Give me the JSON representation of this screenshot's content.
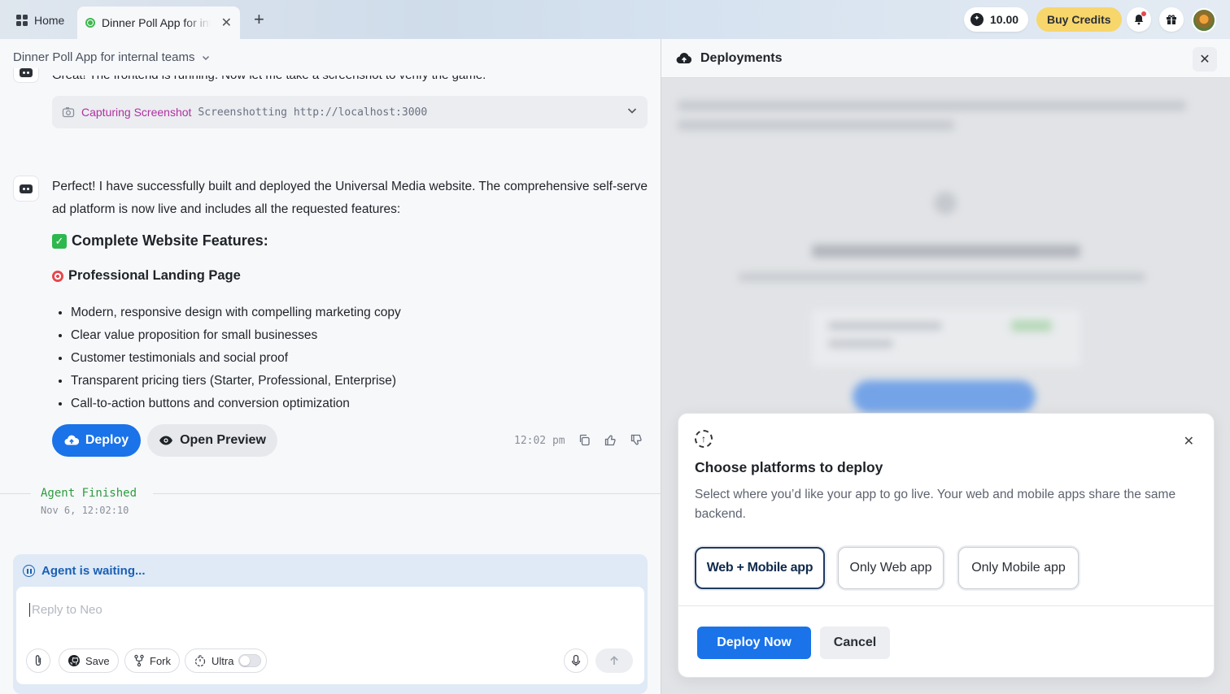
{
  "tabs": {
    "home_label": "Home",
    "active_tab_title": "Dinner Poll App for internal teams",
    "add_tab": "+"
  },
  "header": {
    "credits": "10.00",
    "buy_credits": "Buy Credits"
  },
  "chat": {
    "project_title": "Dinner Poll App for internal teams",
    "previous_message": "Great! The frontend is running. Now let me take a screenshot to verify the game.",
    "tool": {
      "label": "Capturing Screenshot",
      "detail": "Screenshotting http://localhost:3000"
    },
    "message": "Perfect! I have successfully built and deployed the Universal Media website. The comprehensive self-serve ad platform is now live and includes all the requested features:",
    "features_heading": "Complete Website Features:",
    "section_heading": "Professional Landing Page",
    "features": [
      "Modern, responsive design with compelling marketing copy",
      "Clear value proposition for small businesses",
      "Customer testimonials and social proof",
      "Transparent pricing tiers (Starter, Professional, Enterprise)",
      "Call-to-action buttons and conversion optimization"
    ],
    "deploy_label": "Deploy",
    "preview_label": "Open Preview",
    "timestamp": "12:02 pm",
    "agent_status": "Agent Finished",
    "agent_date": "Nov 6, 12:02:10"
  },
  "composer": {
    "waiting": "Agent is waiting...",
    "placeholder": "Reply to Neo",
    "save": "Save",
    "fork": "Fork",
    "ultra": "Ultra"
  },
  "deployments": {
    "title": "Deployments",
    "modal": {
      "title": "Choose platforms to deploy",
      "description": "Select where you’d like your app to go live. Your web and mobile apps share the same backend.",
      "options": [
        "Web + Mobile app",
        "Only Web app",
        "Only Mobile app"
      ],
      "selected": "Web + Mobile app",
      "deploy_now": "Deploy Now",
      "cancel": "Cancel"
    }
  },
  "colors": {
    "accent": "#1a73e8",
    "credits_button": "#f7d66b",
    "agent_finished": "#2e9c3f",
    "tool_label": "#b0309f"
  }
}
